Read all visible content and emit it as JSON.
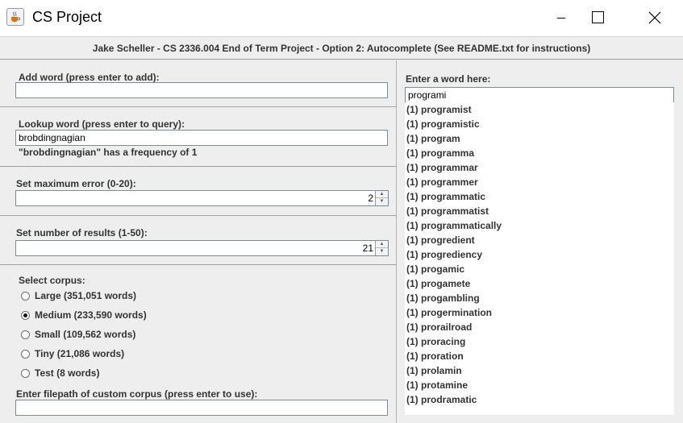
{
  "window": {
    "title": "CS Project",
    "icon": "java-cup-icon"
  },
  "header": {
    "text": "Jake Scheller - CS 2336.004 End of Term Project - Option 2: Autocomplete (See README.txt for instructions)"
  },
  "add_word": {
    "label": "Add word (press enter to add):",
    "value": ""
  },
  "lookup": {
    "label": "Lookup word (press enter to query):",
    "value": "brobdingnagian",
    "result": "\"brobdingnagian\" has a frequency of 1"
  },
  "max_error": {
    "label": "Set maximum error (0-20):",
    "value": "2"
  },
  "num_results": {
    "label": "Set number of results (1-50):",
    "value": "21"
  },
  "corpus": {
    "label": "Select corpus:",
    "options": [
      {
        "label": "Large (351,051 words)",
        "selected": false
      },
      {
        "label": "Medium (233,590 words)",
        "selected": true
      },
      {
        "label": "Small (109,562 words)",
        "selected": false
      },
      {
        "label": "Tiny (21,086 words)",
        "selected": false
      },
      {
        "label": "Test (8 words)",
        "selected": false
      }
    ],
    "custom_label": "Enter filepath of custom corpus (press enter to use):",
    "custom_value": ""
  },
  "autocomplete": {
    "label": "Enter a word here:",
    "value": "programi",
    "results": [
      "(1) programist",
      "(1) programistic",
      "(1) program",
      "(1) programma",
      "(1) programmar",
      "(1) programmer",
      "(1) programmatic",
      "(1) programmatist",
      "(1) programmatically",
      "(1) progredient",
      "(1) progrediency",
      "(1) progamic",
      "(1) progamete",
      "(1) progambling",
      "(1) progermination",
      "(1) prorailroad",
      "(1) proracing",
      "(1) proration",
      "(1) prolamin",
      "(1) protamine",
      "(1) prodramatic"
    ]
  }
}
